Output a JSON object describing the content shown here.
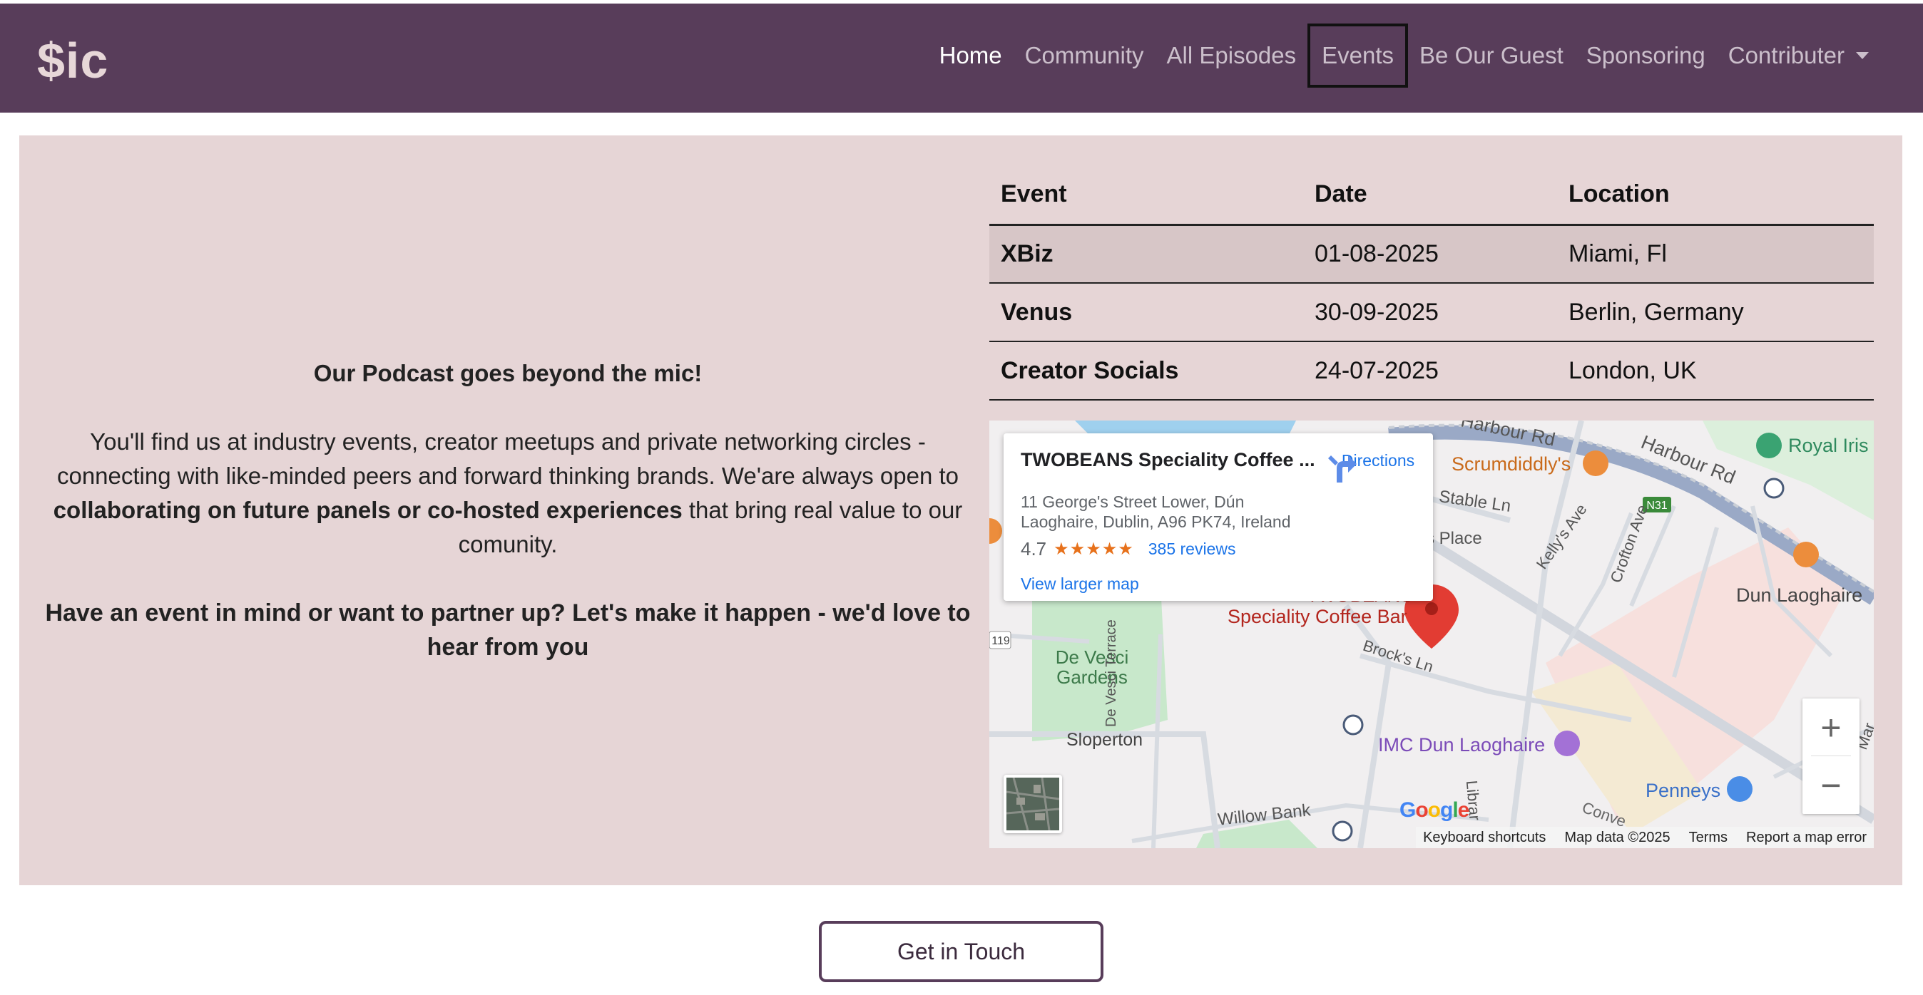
{
  "brand": "$ic",
  "nav": {
    "home": "Home",
    "community": "Community",
    "episodes": "All Episodes",
    "events": "Events",
    "guest": "Be Our Guest",
    "sponsoring": "Sponsoring",
    "contributer": "Contributer"
  },
  "intro": {
    "heading": "Our Podcast goes beyond the mic!",
    "body_pre": "You'll find us at industry events, creator meetups and private networking circles - connecting with like-minded peers and forward thinking brands. We'are always open to ",
    "body_bold": "collaborating on future panels or co-hosted experiences",
    "body_post": " that bring real value to our comunity.",
    "cta": "Have an event in mind or want to partner up? Let's make it happen - we'd love to hear from you"
  },
  "table": {
    "headers": [
      "Event",
      "Date",
      "Location"
    ],
    "rows": [
      {
        "event": "XBiz",
        "date": "01-08-2025",
        "location": "Miami, Fl"
      },
      {
        "event": "Venus",
        "date": "30-09-2025",
        "location": "Berlin, Germany"
      },
      {
        "event": "Creator Socials",
        "date": "24-07-2025",
        "location": "London, UK"
      }
    ]
  },
  "map": {
    "card": {
      "title": "TWOBEANS Speciality Coffee ...",
      "address": "11 George's Street Lower, Dún Laoghaire, Dublin, A96 PK74, Ireland",
      "rating": "4.7",
      "stars": "★★★★★",
      "reviews": "385 reviews",
      "larger_map": "View larger map",
      "directions": "Directions"
    },
    "labels": {
      "harbour_rd": "Harbour Rd",
      "royal": "Royal Iris",
      "scrumdiddlys": "Scrumdiddly's",
      "stable": "Stable Ln",
      "place": "s Place",
      "kellys": "Kelly's Ave",
      "crofton": "Crofton Ave",
      "n31": "N31",
      "dun": "Dun Laoghaire",
      "pin_line1": "TWOBEANS",
      "pin_line2": "Speciality Coffee Bar",
      "brocks": "Brock's Ln",
      "vesci": "De Vesci Gardens",
      "vesci_terr": "De Vesci Terrace",
      "sloperton": "Sloperton",
      "imc": "IMC Dun Laoghaire",
      "penneys": "Penneys",
      "willow": "Willow Bank",
      "r119": "119",
      "conv": "Conve",
      "library": "Librar",
      "mar": "Mar"
    },
    "google": "Google",
    "attrib": {
      "shortcuts": "Keyboard shortcuts",
      "data": "Map data ©2025",
      "terms": "Terms",
      "report": "Report a map error"
    }
  },
  "button": "Get in Touch"
}
